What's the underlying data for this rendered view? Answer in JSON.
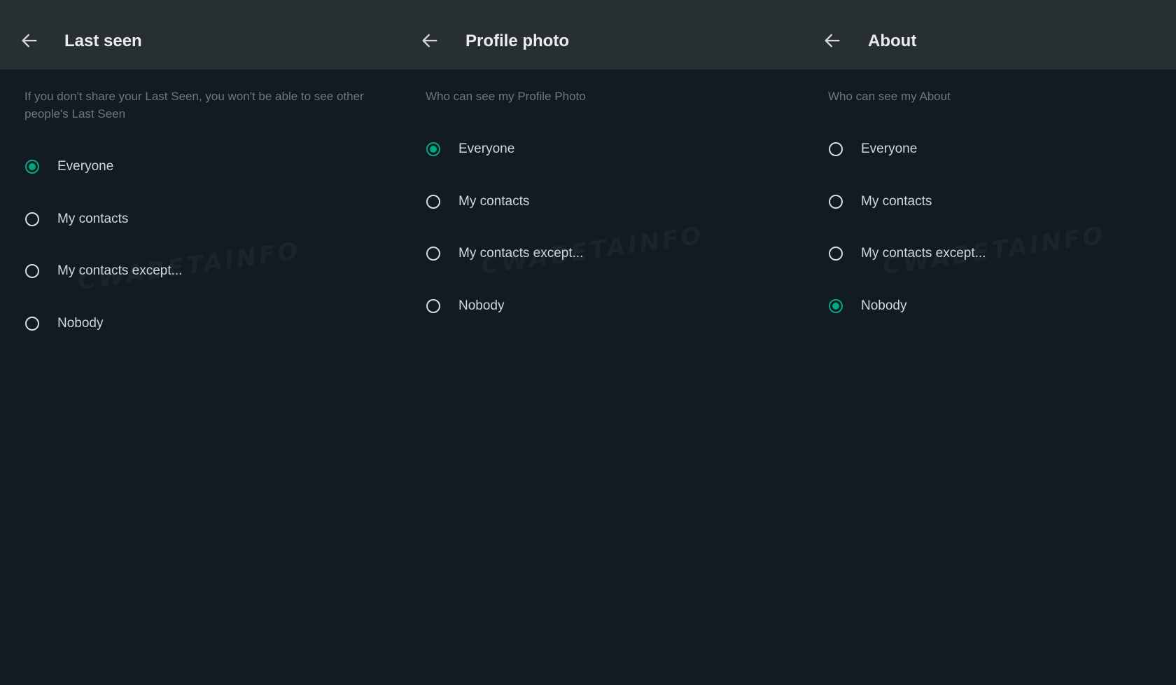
{
  "colors": {
    "background": "#111b21",
    "header": "#282f33",
    "accent": "#00a884",
    "title_text": "#e9edef",
    "option_text": "#d1d7db",
    "description_text": "#6b7880"
  },
  "watermark": "CWABETAINFO",
  "panels": [
    {
      "back_icon": "arrow-left-icon",
      "title": "Last seen",
      "description": "If you don't share your Last Seen, you won't be able to see other people's Last Seen",
      "options": [
        {
          "label": "Everyone",
          "checked": true
        },
        {
          "label": "My contacts",
          "checked": false
        },
        {
          "label": "My contacts except...",
          "checked": false
        },
        {
          "label": "Nobody",
          "checked": false
        }
      ]
    },
    {
      "back_icon": "arrow-left-icon",
      "title": "Profile photo",
      "description": "Who can see my Profile Photo",
      "options": [
        {
          "label": "Everyone",
          "checked": true
        },
        {
          "label": "My contacts",
          "checked": false
        },
        {
          "label": "My contacts except...",
          "checked": false
        },
        {
          "label": "Nobody",
          "checked": false
        }
      ]
    },
    {
      "back_icon": "arrow-left-icon",
      "title": "About",
      "description": "Who can see my About",
      "options": [
        {
          "label": "Everyone",
          "checked": false
        },
        {
          "label": "My contacts",
          "checked": false
        },
        {
          "label": "My contacts except...",
          "checked": false
        },
        {
          "label": "Nobody",
          "checked": true
        }
      ]
    }
  ]
}
